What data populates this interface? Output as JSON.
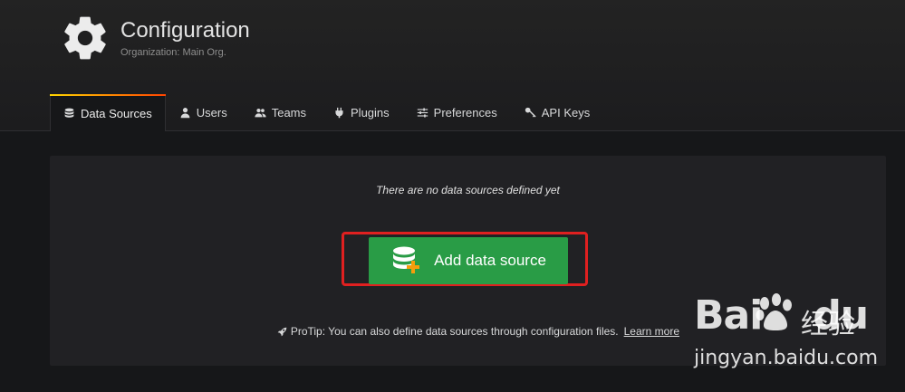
{
  "header": {
    "title": "Configuration",
    "subtitle": "Organization: Main Org."
  },
  "tabs": [
    {
      "label": "Data Sources",
      "icon": "database-icon",
      "active": true
    },
    {
      "label": "Users",
      "icon": "user-icon",
      "active": false
    },
    {
      "label": "Teams",
      "icon": "users-icon",
      "active": false
    },
    {
      "label": "Plugins",
      "icon": "plug-icon",
      "active": false
    },
    {
      "label": "Preferences",
      "icon": "sliders-icon",
      "active": false
    },
    {
      "label": "API Keys",
      "icon": "key-icon",
      "active": false
    }
  ],
  "empty_state": {
    "message": "There are no data sources defined yet",
    "button_label": "Add data source",
    "protip_text": "ProTip: You can also define data sources through configuration files.",
    "learn_more": "Learn more"
  },
  "watermark": {
    "logo_text": "Bai",
    "logo_text_2": "du",
    "cn_text": "经验",
    "url": "jingyan.baidu.com"
  },
  "colors": {
    "accent_green": "#299c46",
    "highlight_red": "#e02020",
    "tab_gradient_start": "#ffd500",
    "tab_gradient_end": "#ff4400"
  }
}
